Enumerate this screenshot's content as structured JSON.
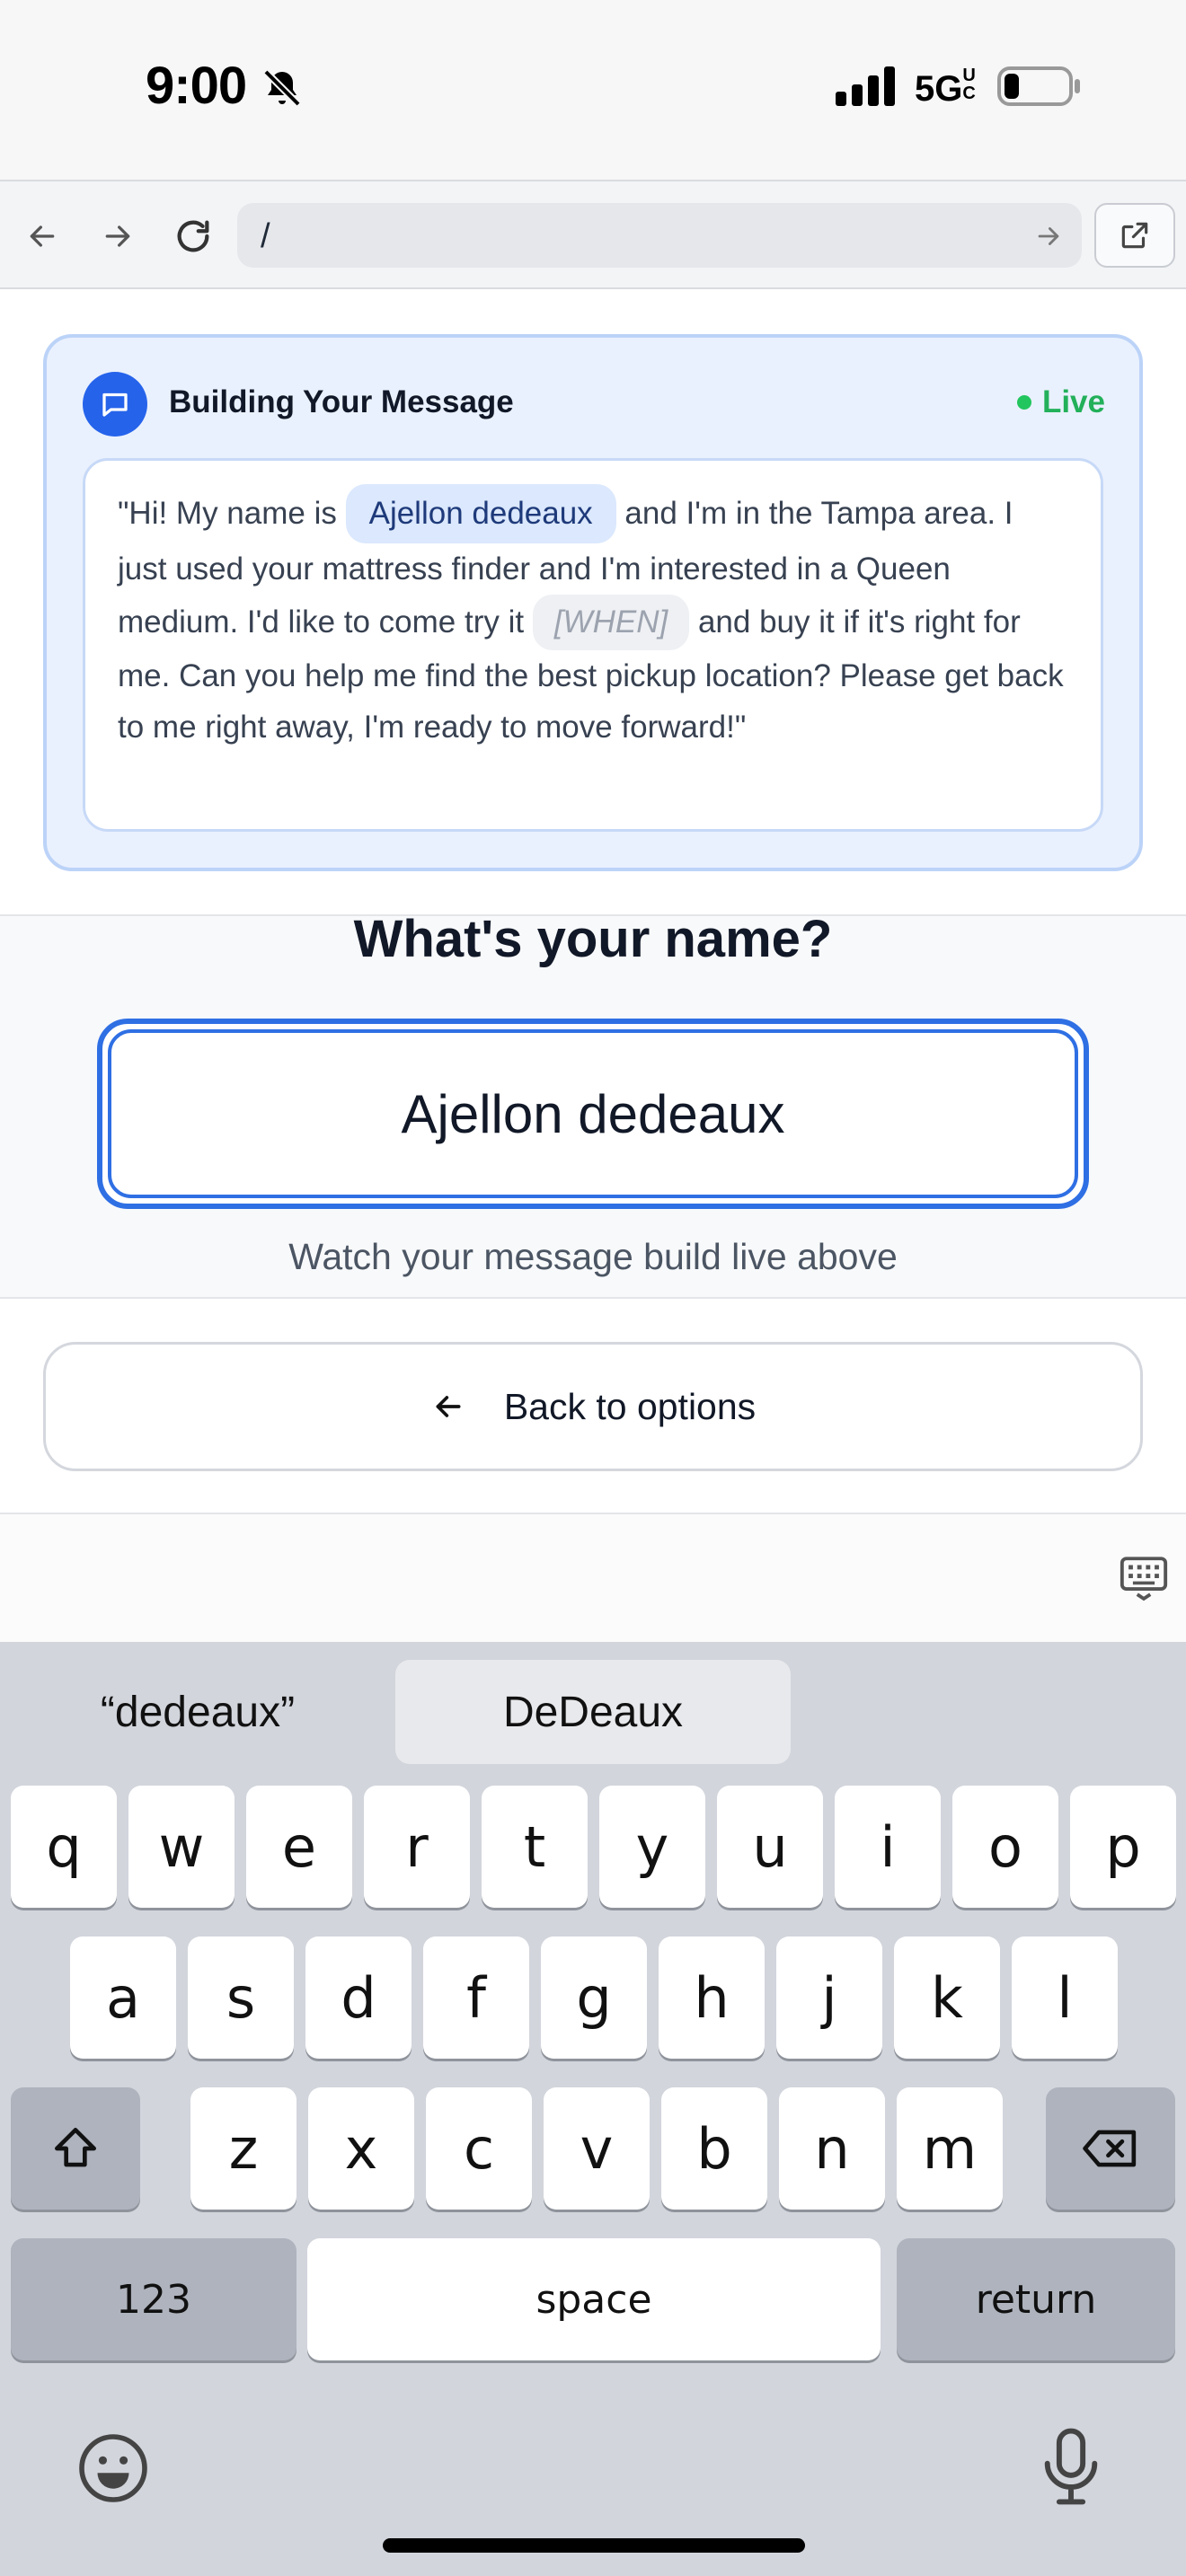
{
  "status_bar": {
    "time": "9:00",
    "network": "5G",
    "network_suffix": "UC"
  },
  "browser": {
    "url": "/"
  },
  "message_card": {
    "title": "Building Your Message",
    "live_label": "Live",
    "text_1": "\"Hi! My name is ",
    "name_chip": "Ajellon dedeaux",
    "text_2": " and I'm in the Tampa area. I just used your mattress finder and I'm interested in a Queen medium. I'd like to come try it ",
    "when_chip": "[WHEN]",
    "text_3": " and buy it if it's right for me. Can you help me find the best pickup location? Please get back to me right away, I'm ready to move forward!\""
  },
  "question": {
    "title": "What's your name?",
    "input_value": "Ajellon dedeaux",
    "hint": "Watch your message build live above"
  },
  "back_button": {
    "label": "Back to options"
  },
  "keyboard": {
    "suggestions": [
      "“dedeaux”",
      "DeDeaux"
    ],
    "row1": [
      "q",
      "w",
      "e",
      "r",
      "t",
      "y",
      "u",
      "i",
      "o",
      "p"
    ],
    "row2": [
      "a",
      "s",
      "d",
      "f",
      "g",
      "h",
      "j",
      "k",
      "l"
    ],
    "row3": [
      "z",
      "x",
      "c",
      "v",
      "b",
      "n",
      "m"
    ],
    "numbers_label": "123",
    "space_label": "space",
    "return_label": "return"
  },
  "colors": {
    "accent": "#2563eb",
    "live": "#22c55e",
    "card_bg": "#eaf1fe"
  }
}
